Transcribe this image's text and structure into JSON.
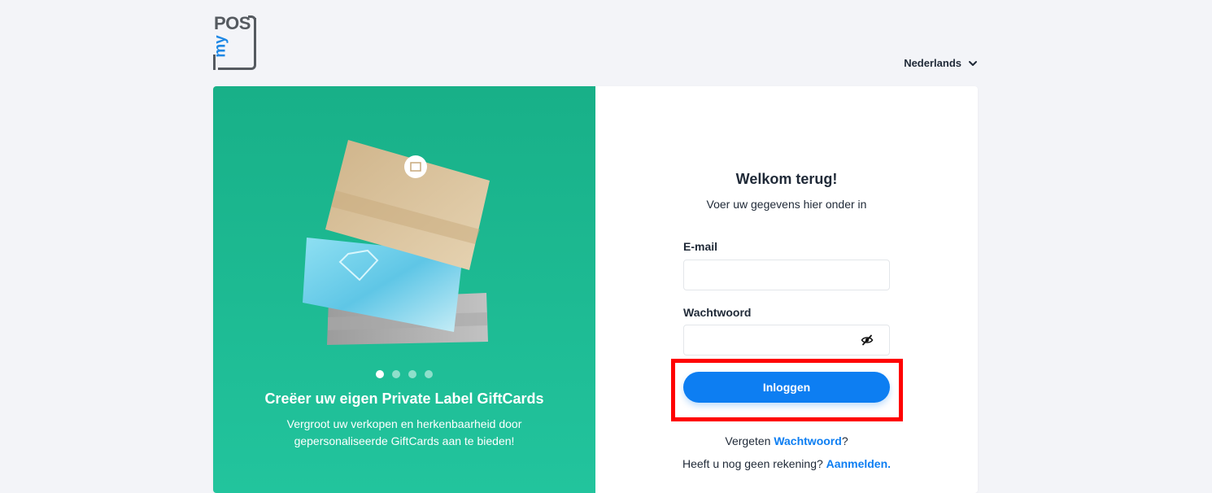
{
  "brand": {
    "logo_main": "POS",
    "logo_prefix": "my"
  },
  "header": {
    "language": "Nederlands",
    "language_icon": "chevron-down-icon"
  },
  "promo": {
    "title": "Creëer uw eigen Private Label GiftCards",
    "text": "Vergroot uw verkopen en herkenbaarheid door gepersonaliseerde GiftCards aan te bieden!",
    "slides_total": 4,
    "active_slide": 1
  },
  "login": {
    "title": "Welkom terug!",
    "subtitle": "Voer uw gegevens hier onder in",
    "email_label": "E-mail",
    "email_value": "",
    "password_label": "Wachtwoord",
    "password_value": "",
    "password_toggle_icon": "eye-slash-icon",
    "submit_label": "Inloggen",
    "forgot_prefix": "Vergeten ",
    "forgot_link": "Wachtwoord",
    "forgot_suffix": "?",
    "signup_prefix": "Heeft u nog geen rekening? ",
    "signup_link": "Aanmelden."
  },
  "colors": {
    "accent": "#0d7ef2",
    "promo_bg": "#1bb78f",
    "highlight": "#ff0000",
    "page_bg": "#f3f4f8"
  }
}
